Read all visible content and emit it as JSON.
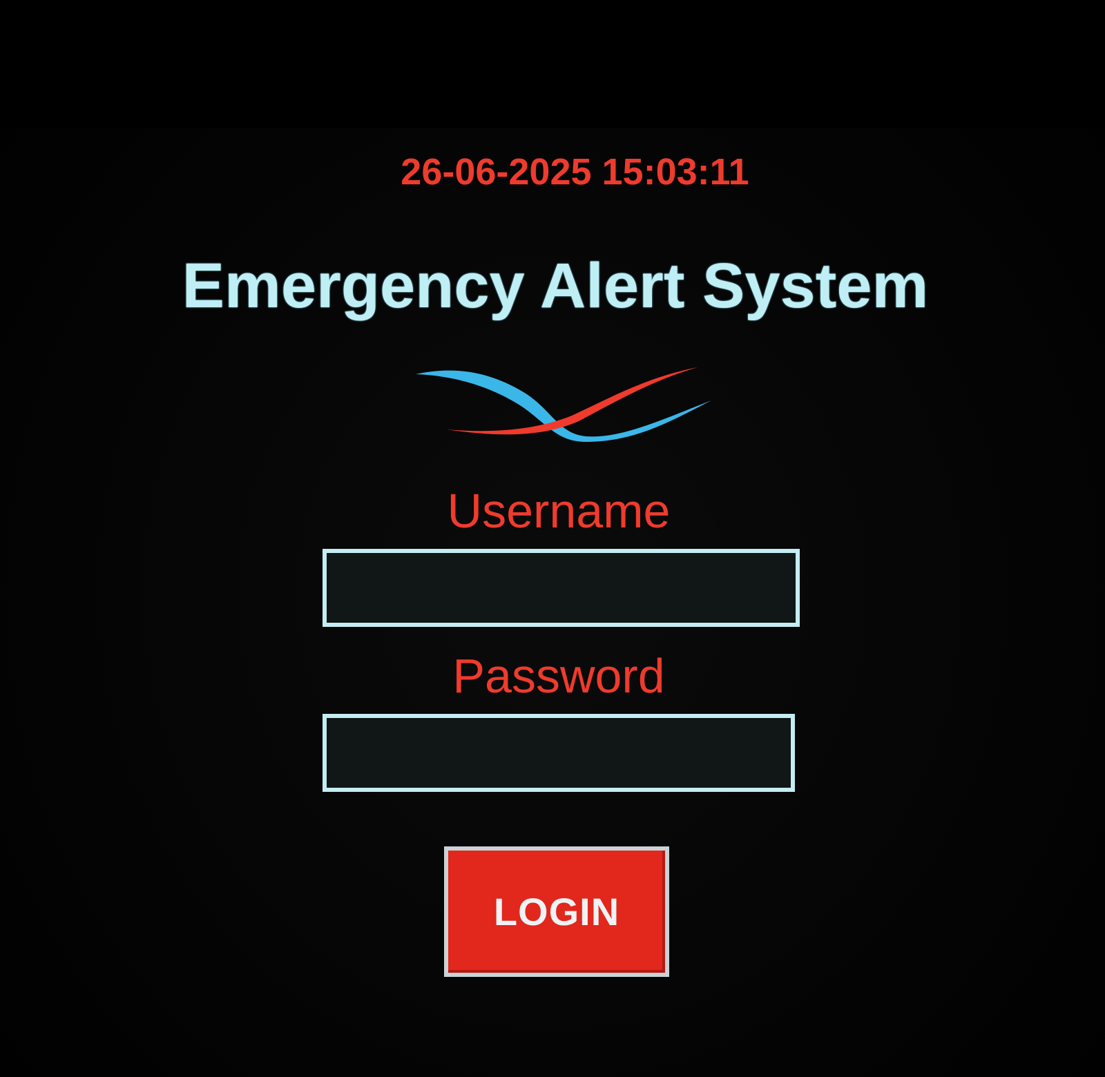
{
  "datetime": "26-06-2025 15:03:11",
  "title": "Emergency Alert System",
  "logo": {
    "icon": "crossed-waves-logo-icon",
    "colors": [
      "#3bb6e8",
      "#ef3b2d"
    ]
  },
  "form": {
    "username_label": "Username",
    "username_value": "",
    "password_label": "Password",
    "password_value": "",
    "login_label": "LOGIN"
  },
  "colors": {
    "background": "#000000",
    "accent_red": "#ef3b2d",
    "title_cyan": "#bfeef5",
    "field_border": "#c4edf3",
    "button_red": "#e2271d"
  }
}
